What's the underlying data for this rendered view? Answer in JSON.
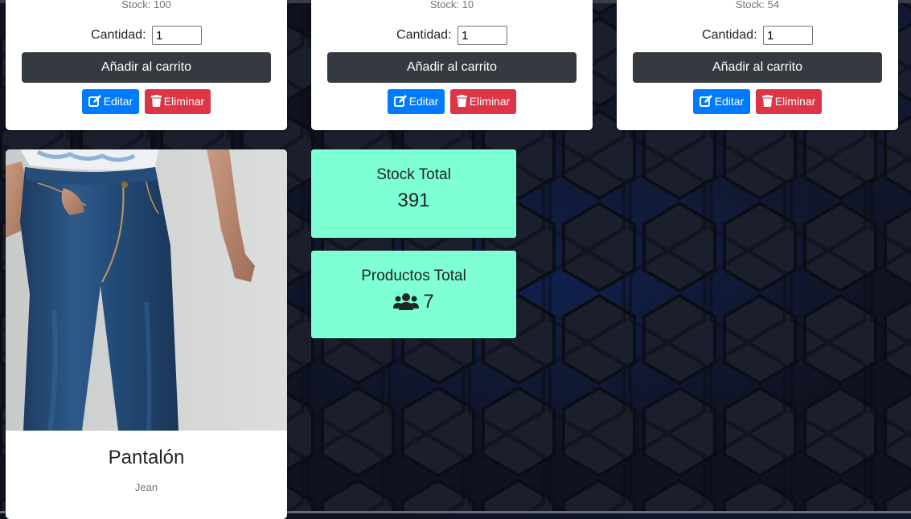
{
  "cards": [
    {
      "stock_text": "Stock: 100",
      "qty_label": "Cantidad:",
      "qty_value": "1",
      "add_label": "Añadir al carrito",
      "edit_label": "Editar",
      "delete_label": "Eliminar"
    },
    {
      "stock_text": "Stock: 10",
      "qty_label": "Cantidad:",
      "qty_value": "1",
      "add_label": "Añadir al carrito",
      "edit_label": "Editar",
      "delete_label": "Eliminar"
    },
    {
      "stock_text": "Stock: 54",
      "qty_label": "Cantidad:",
      "qty_value": "1",
      "add_label": "Añadir al carrito",
      "edit_label": "Editar",
      "delete_label": "Eliminar"
    }
  ],
  "product": {
    "title": "Pantalón",
    "subtitle": "Jean",
    "image": "jeans-photo"
  },
  "stats": {
    "stock_total": {
      "title": "Stock Total",
      "value": "391"
    },
    "productos_total": {
      "title": "Productos Total",
      "value": "7",
      "icon": "users-icon"
    }
  },
  "colors": {
    "edit": "#007bff",
    "delete": "#dc3545",
    "add": "#343a40",
    "stat_bg": "#7fffd4"
  }
}
